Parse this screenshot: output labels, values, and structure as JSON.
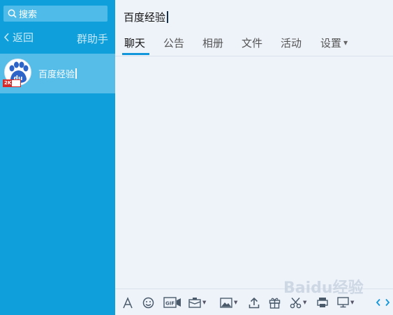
{
  "sidebar": {
    "search_placeholder": "搜索",
    "back_label": "返回",
    "group_helper_label": "群助手",
    "conversations": [
      {
        "name": "百度经验",
        "badge": "2K"
      }
    ]
  },
  "main": {
    "title": "百度经验",
    "tabs": [
      {
        "label": "聊天",
        "active": true
      },
      {
        "label": "公告"
      },
      {
        "label": "相册"
      },
      {
        "label": "文件"
      },
      {
        "label": "活动"
      },
      {
        "label": "设置",
        "has_dropdown": true
      }
    ],
    "toolbar_icons": [
      "font-icon",
      "emoji-icon",
      "gif-icon",
      "hongbao-icon",
      "image-icon",
      "upload-icon",
      "gift-icon",
      "scissors-icon",
      "printer-icon",
      "screen-icon",
      "nav-left-icon",
      "nav-right-icon"
    ]
  },
  "watermark": {
    "brand": "Baidu",
    "suffix": "经验"
  },
  "colors": {
    "sidebar": "#0fa0dc",
    "selected_conv": "#56bce8",
    "main_bg": "#eef3fa",
    "accent": "#1296db"
  }
}
